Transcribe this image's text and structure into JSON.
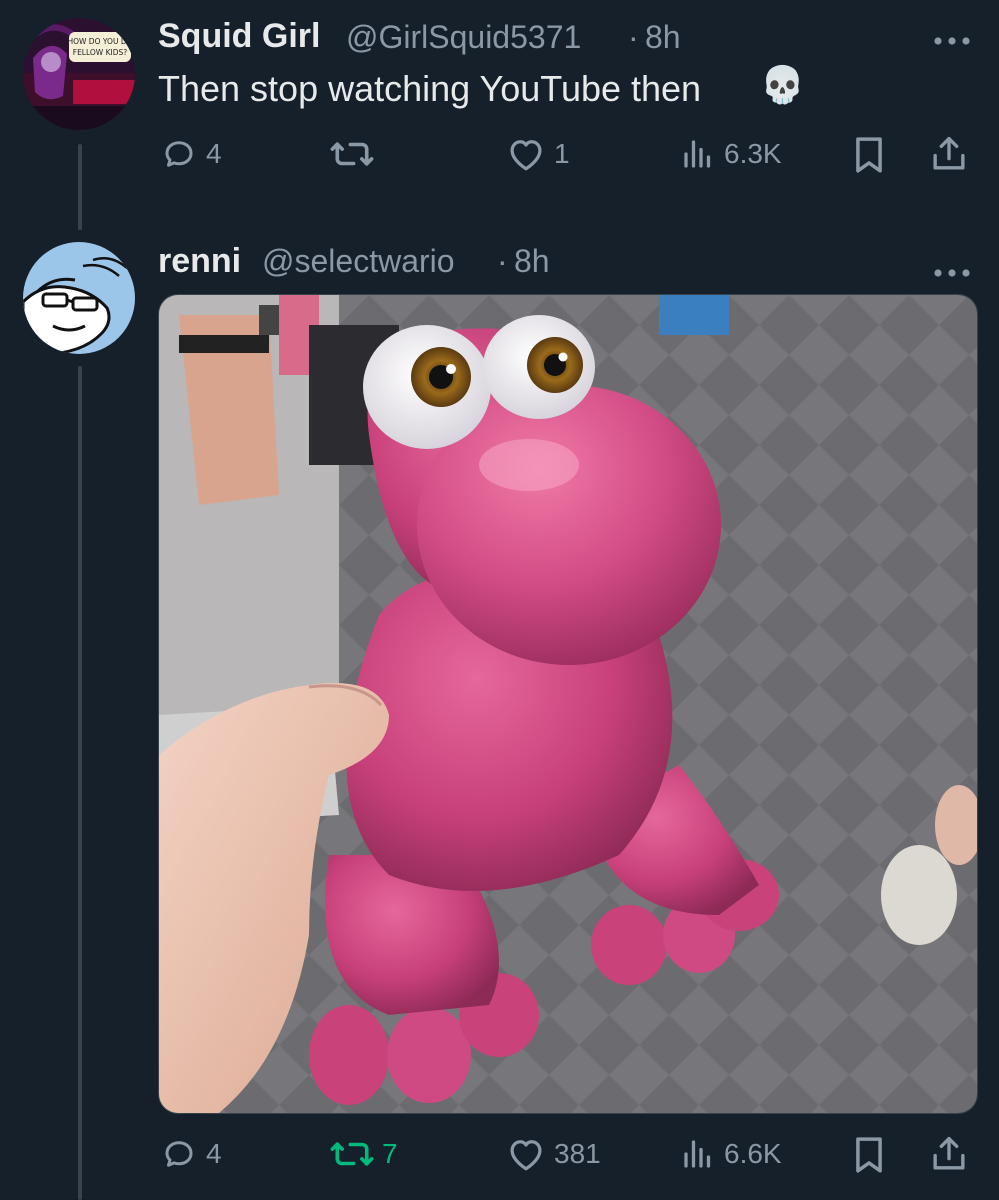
{
  "tweet1": {
    "display_name": "Squid Girl",
    "handle": "@GirlSquid5371",
    "separator": "·",
    "time": "8h",
    "text": "Then stop watching YouTube then",
    "emoji": "💀",
    "avatar_caption_line1": "HOW DO YOU DO",
    "avatar_caption_line2": "FELLOW KIDS?",
    "replies": "4",
    "retweets": "",
    "likes": "1",
    "views": "6.3K"
  },
  "tweet2": {
    "display_name": "renni",
    "handle": "@selectwario",
    "separator": "·",
    "time": "8h",
    "replies": "4",
    "retweets": "7",
    "likes": "381",
    "views": "6.6K",
    "colors": {
      "retweet_active": "#00ba7c"
    }
  },
  "icons": {
    "more": "more-dots-icon",
    "reply": "reply-bubble-icon",
    "retweet": "retweet-arrows-icon",
    "like": "heart-icon",
    "views": "bar-chart-icon",
    "bookmark": "bookmark-icon",
    "share": "share-upload-icon"
  },
  "theme": {
    "background": "#15202b",
    "text": "#e7e9ea",
    "muted": "#8b98a5"
  }
}
